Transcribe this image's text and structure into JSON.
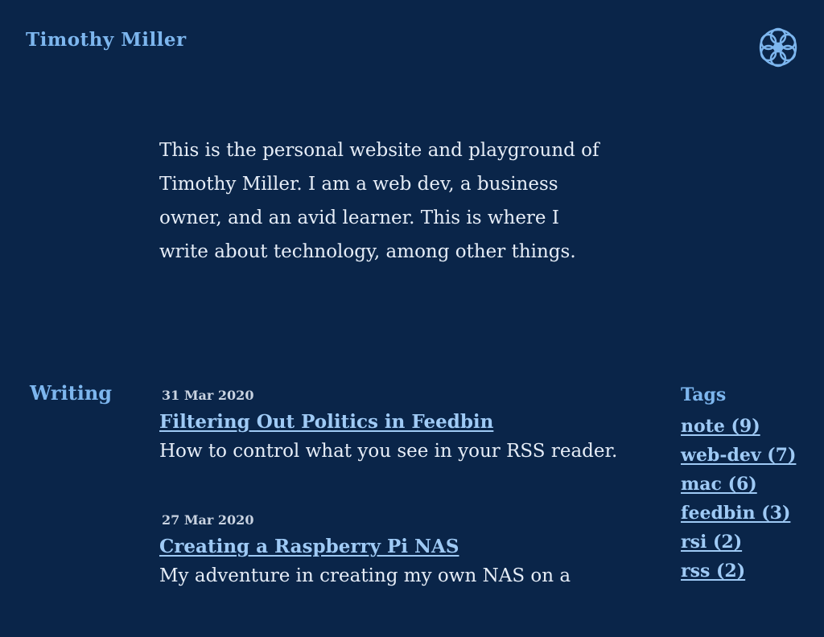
{
  "site": {
    "title": "Timothy Miller",
    "logo_icon": "flower-rosette-icon",
    "accent_color": "#7db6ee",
    "background_color": "#0a2549"
  },
  "intro": {
    "text": "This is the personal website and playground of Timothy Miller. I am a web dev, a business owner, and an avid learner. This is where I write about technology, among other things."
  },
  "writing": {
    "heading": "Writing",
    "posts": [
      {
        "date": "31 Mar 2020",
        "title": "Filtering Out Politics in Feedbin",
        "description": "How to control what you see in your RSS reader."
      },
      {
        "date": "27 Mar 2020",
        "title": "Creating a Raspberry Pi NAS",
        "description": "My adventure in creating my own NAS on a"
      }
    ]
  },
  "tags": {
    "heading": "Tags",
    "items": [
      {
        "label": "note (9)"
      },
      {
        "label": "web-dev (7)"
      },
      {
        "label": "mac (6)"
      },
      {
        "label": "feedbin (3)"
      },
      {
        "label": "rsi (2)"
      },
      {
        "label": "rss (2)"
      }
    ]
  }
}
